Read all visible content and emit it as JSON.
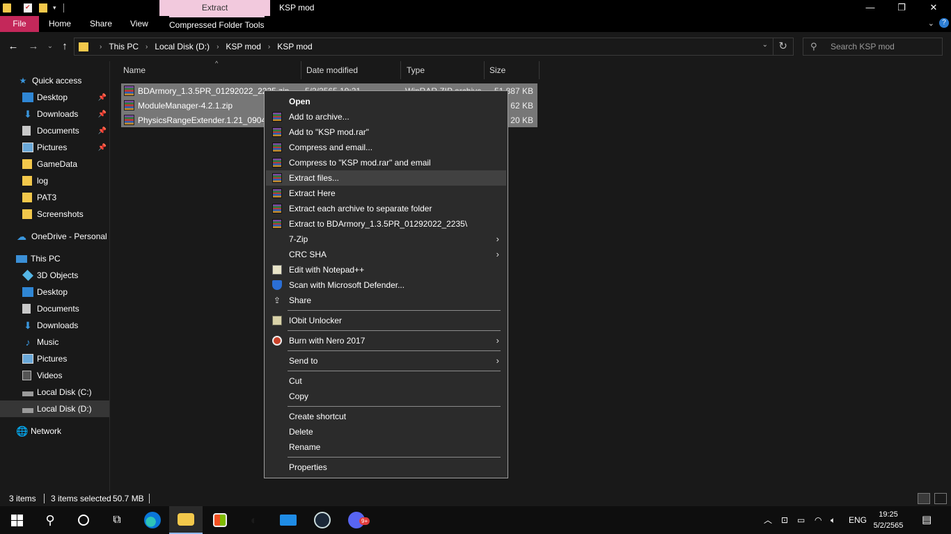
{
  "window": {
    "title": "KSP mod",
    "contextual_tab_title": "Extract"
  },
  "ribbon": {
    "tabs": [
      "File",
      "Home",
      "Share",
      "View",
      "Compressed Folder Tools"
    ]
  },
  "address": {
    "crumbs": [
      "This PC",
      "Local Disk (D:)",
      "KSP mod",
      "KSP mod"
    ],
    "search_placeholder": "Search KSP mod"
  },
  "sidebar": {
    "items": [
      {
        "label": "Quick access",
        "icon": "star-icon"
      },
      {
        "label": "Desktop",
        "icon": "desktop-icon",
        "pinned": true
      },
      {
        "label": "Downloads",
        "icon": "download-icon",
        "pinned": true
      },
      {
        "label": "Documents",
        "icon": "document-icon",
        "pinned": true
      },
      {
        "label": "Pictures",
        "icon": "picture-icon",
        "pinned": true
      },
      {
        "label": "GameData",
        "icon": "folder-icon"
      },
      {
        "label": "log",
        "icon": "folder-icon"
      },
      {
        "label": "PAT3",
        "icon": "folder-icon"
      },
      {
        "label": "Screenshots",
        "icon": "folder-icon"
      },
      {
        "label": "OneDrive - Personal",
        "icon": "cloud-icon"
      },
      {
        "label": "This PC",
        "icon": "computer-icon"
      },
      {
        "label": "3D Objects",
        "icon": "cube-icon"
      },
      {
        "label": "Desktop",
        "icon": "desktop-icon"
      },
      {
        "label": "Documents",
        "icon": "document-icon"
      },
      {
        "label": "Downloads",
        "icon": "download-icon"
      },
      {
        "label": "Music",
        "icon": "music-icon"
      },
      {
        "label": "Pictures",
        "icon": "picture-icon"
      },
      {
        "label": "Videos",
        "icon": "video-icon"
      },
      {
        "label": "Local Disk (C:)",
        "icon": "drive-icon"
      },
      {
        "label": "Local Disk (D:)",
        "icon": "drive-icon",
        "selected": true
      },
      {
        "label": "Network",
        "icon": "network-icon"
      }
    ]
  },
  "columns": [
    "Name",
    "Date modified",
    "Type",
    "Size"
  ],
  "files": [
    {
      "name": "BDArmory_1.3.5PR_01292022_2235.zip",
      "date": "5/2/2565 19:21",
      "type": "WinRAR ZIP archive",
      "size": "51,887 KB"
    },
    {
      "name": "ModuleManager-4.2.1.zip",
      "date": "",
      "type": "",
      "size": "62 KB"
    },
    {
      "name": "PhysicsRangeExtender.1.21_090420",
      "date": "",
      "type": "",
      "size": "20 KB"
    }
  ],
  "context_menu": {
    "items": [
      {
        "label": "Open",
        "bold": true
      },
      {
        "label": "Add to archive...",
        "icon": "winrar-icon"
      },
      {
        "label": "Add to \"KSP mod.rar\"",
        "icon": "winrar-icon"
      },
      {
        "label": "Compress and email...",
        "icon": "winrar-icon"
      },
      {
        "label": "Compress to \"KSP mod.rar\" and email",
        "icon": "winrar-icon"
      },
      {
        "label": "Extract files...",
        "icon": "winrar-icon",
        "hover": true
      },
      {
        "label": "Extract Here",
        "icon": "winrar-icon"
      },
      {
        "label": "Extract each archive to separate folder",
        "icon": "winrar-icon"
      },
      {
        "label": "Extract to BDArmory_1.3.5PR_01292022_2235\\",
        "icon": "winrar-icon"
      },
      {
        "label": "7-Zip",
        "submenu": true
      },
      {
        "label": "CRC SHA",
        "submenu": true
      },
      {
        "label": "Edit with Notepad++",
        "icon": "notepadpp-icon"
      },
      {
        "label": "Scan with Microsoft Defender...",
        "icon": "defender-icon"
      },
      {
        "label": "Share",
        "icon": "share-icon"
      },
      {
        "label": "IObit Unlocker",
        "icon": "iobit-icon"
      },
      {
        "label": "Burn with Nero 2017",
        "icon": "nero-icon",
        "submenu": true
      },
      {
        "label": "Send to",
        "submenu": true
      },
      {
        "label": "Cut"
      },
      {
        "label": "Copy"
      },
      {
        "label": "Create shortcut"
      },
      {
        "label": "Delete"
      },
      {
        "label": "Rename"
      },
      {
        "label": "Properties"
      }
    ]
  },
  "status": {
    "items_count": "3 items",
    "selected": "3 items selected",
    "size": "50.7 MB"
  },
  "taskbar": {
    "clock_time": "19:25",
    "clock_date": "5/2/2565",
    "language": "ENG",
    "steam_badge": "9+"
  },
  "colors": {
    "file_tab": "#c4285a",
    "extract_tab": "#f2c9dd",
    "selection": "#777777",
    "menu_bg": "#2b2b2b"
  }
}
